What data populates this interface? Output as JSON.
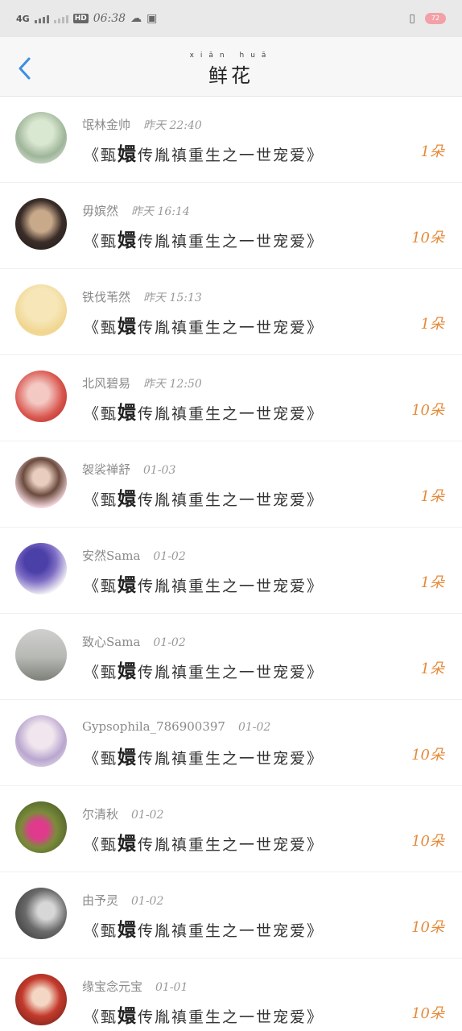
{
  "status": {
    "network": "4G",
    "hd": "HD",
    "time": "06:38",
    "battery": "72"
  },
  "header": {
    "pinyin": "xiān huā",
    "title": "鲜花"
  },
  "gifts": [
    {
      "name": "氓林金帅",
      "when": "昨天 22:40",
      "song_prefix": "《甄",
      "song_big": "嬛",
      "song_rest": "传胤禛重生之一世宠爱》",
      "count": "1朵"
    },
    {
      "name": "毋嫔然",
      "when": "昨天 16:14",
      "song_prefix": "《甄",
      "song_big": "嬛",
      "song_rest": "传胤禛重生之一世宠爱》",
      "count": "10朵"
    },
    {
      "name": "铁伐苇然",
      "when": "昨天 15:13",
      "song_prefix": "《甄",
      "song_big": "嬛",
      "song_rest": "传胤禛重生之一世宠爱》",
      "count": "1朵"
    },
    {
      "name": "北风碧易",
      "when": "昨天 12:50",
      "song_prefix": "《甄",
      "song_big": "嬛",
      "song_rest": "传胤禛重生之一世宠爱》",
      "count": "10朵"
    },
    {
      "name": "袈裟禅舒",
      "when": "01-03",
      "song_prefix": "《甄",
      "song_big": "嬛",
      "song_rest": "传胤禛重生之一世宠爱》",
      "count": "1朵"
    },
    {
      "name": "安然Sama",
      "when": "01-02",
      "song_prefix": "《甄",
      "song_big": "嬛",
      "song_rest": "传胤禛重生之一世宠爱》",
      "count": "1朵"
    },
    {
      "name": "致心Sama",
      "when": "01-02",
      "song_prefix": "《甄",
      "song_big": "嬛",
      "song_rest": "传胤禛重生之一世宠爱》",
      "count": "1朵"
    },
    {
      "name": "Gypsophila_786900397",
      "when": "01-02",
      "song_prefix": "《甄",
      "song_big": "嬛",
      "song_rest": "传胤禛重生之一世宠爱》",
      "count": "10朵"
    },
    {
      "name": "尔清秋",
      "when": "01-02",
      "song_prefix": "《甄",
      "song_big": "嬛",
      "song_rest": "传胤禛重生之一世宠爱》",
      "count": "10朵"
    },
    {
      "name": "由予灵",
      "when": "01-02",
      "song_prefix": "《甄",
      "song_big": "嬛",
      "song_rest": "传胤禛重生之一世宠爱》",
      "count": "10朵"
    },
    {
      "name": "缘宝念元宝",
      "when": "01-01",
      "song_prefix": "《甄",
      "song_big": "嬛",
      "song_rest": "传胤禛重生之一世宠爱》",
      "count": "10朵"
    }
  ],
  "colors": {
    "accent_count": "#e58a3a",
    "back_arrow": "#3b8fe0"
  },
  "icons": {
    "back": "chevron-left-icon",
    "signal": "signal-icon",
    "cloud": "cloud-icon",
    "photo": "photo-icon",
    "vibrate": "vibrate-icon",
    "battery": "battery-icon"
  }
}
